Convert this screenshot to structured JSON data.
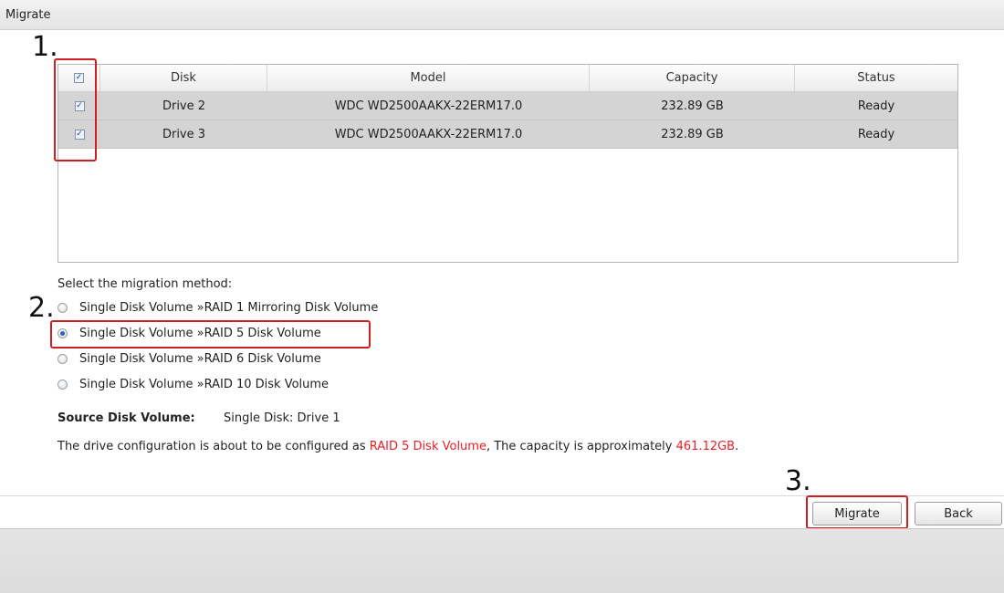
{
  "window": {
    "title": "Migrate"
  },
  "annotations": {
    "step1": "1.",
    "step2": "2.",
    "step3": "3."
  },
  "table": {
    "columns": [
      "Disk",
      "Model",
      "Capacity",
      "Status"
    ],
    "select_all_checked": true,
    "rows": [
      {
        "checked": true,
        "disk": "Drive 2",
        "model": "WDC WD2500AAKX-22ERM17.0",
        "capacity": "232.89 GB",
        "status": "Ready"
      },
      {
        "checked": true,
        "disk": "Drive 3",
        "model": "WDC WD2500AAKX-22ERM17.0",
        "capacity": "232.89 GB",
        "status": "Ready"
      }
    ]
  },
  "migration": {
    "prompt": "Select the migration method:",
    "options": [
      {
        "label": "Single Disk Volume »RAID 1 Mirroring Disk Volume",
        "selected": false
      },
      {
        "label": "Single Disk Volume »RAID 5 Disk Volume",
        "selected": true
      },
      {
        "label": "Single Disk Volume »RAID 6 Disk Volume",
        "selected": false
      },
      {
        "label": "Single Disk Volume »RAID 10 Disk Volume",
        "selected": false
      }
    ]
  },
  "source": {
    "label": "Source Disk Volume:",
    "value": "Single Disk: Drive 1"
  },
  "summary": {
    "prefix": "The drive configuration is about to be configured as ",
    "raid": "RAID 5 Disk Volume",
    "middle": ", The capacity is approximately ",
    "capacity": "461.12GB",
    "suffix": "."
  },
  "buttons": {
    "migrate": "Migrate",
    "back": "Back"
  },
  "colors": {
    "highlight": "#cc1f1f",
    "emphasis": "#ee1c24",
    "row_bg": "#d4d4d4",
    "radio_selected": "#2a63b8"
  }
}
